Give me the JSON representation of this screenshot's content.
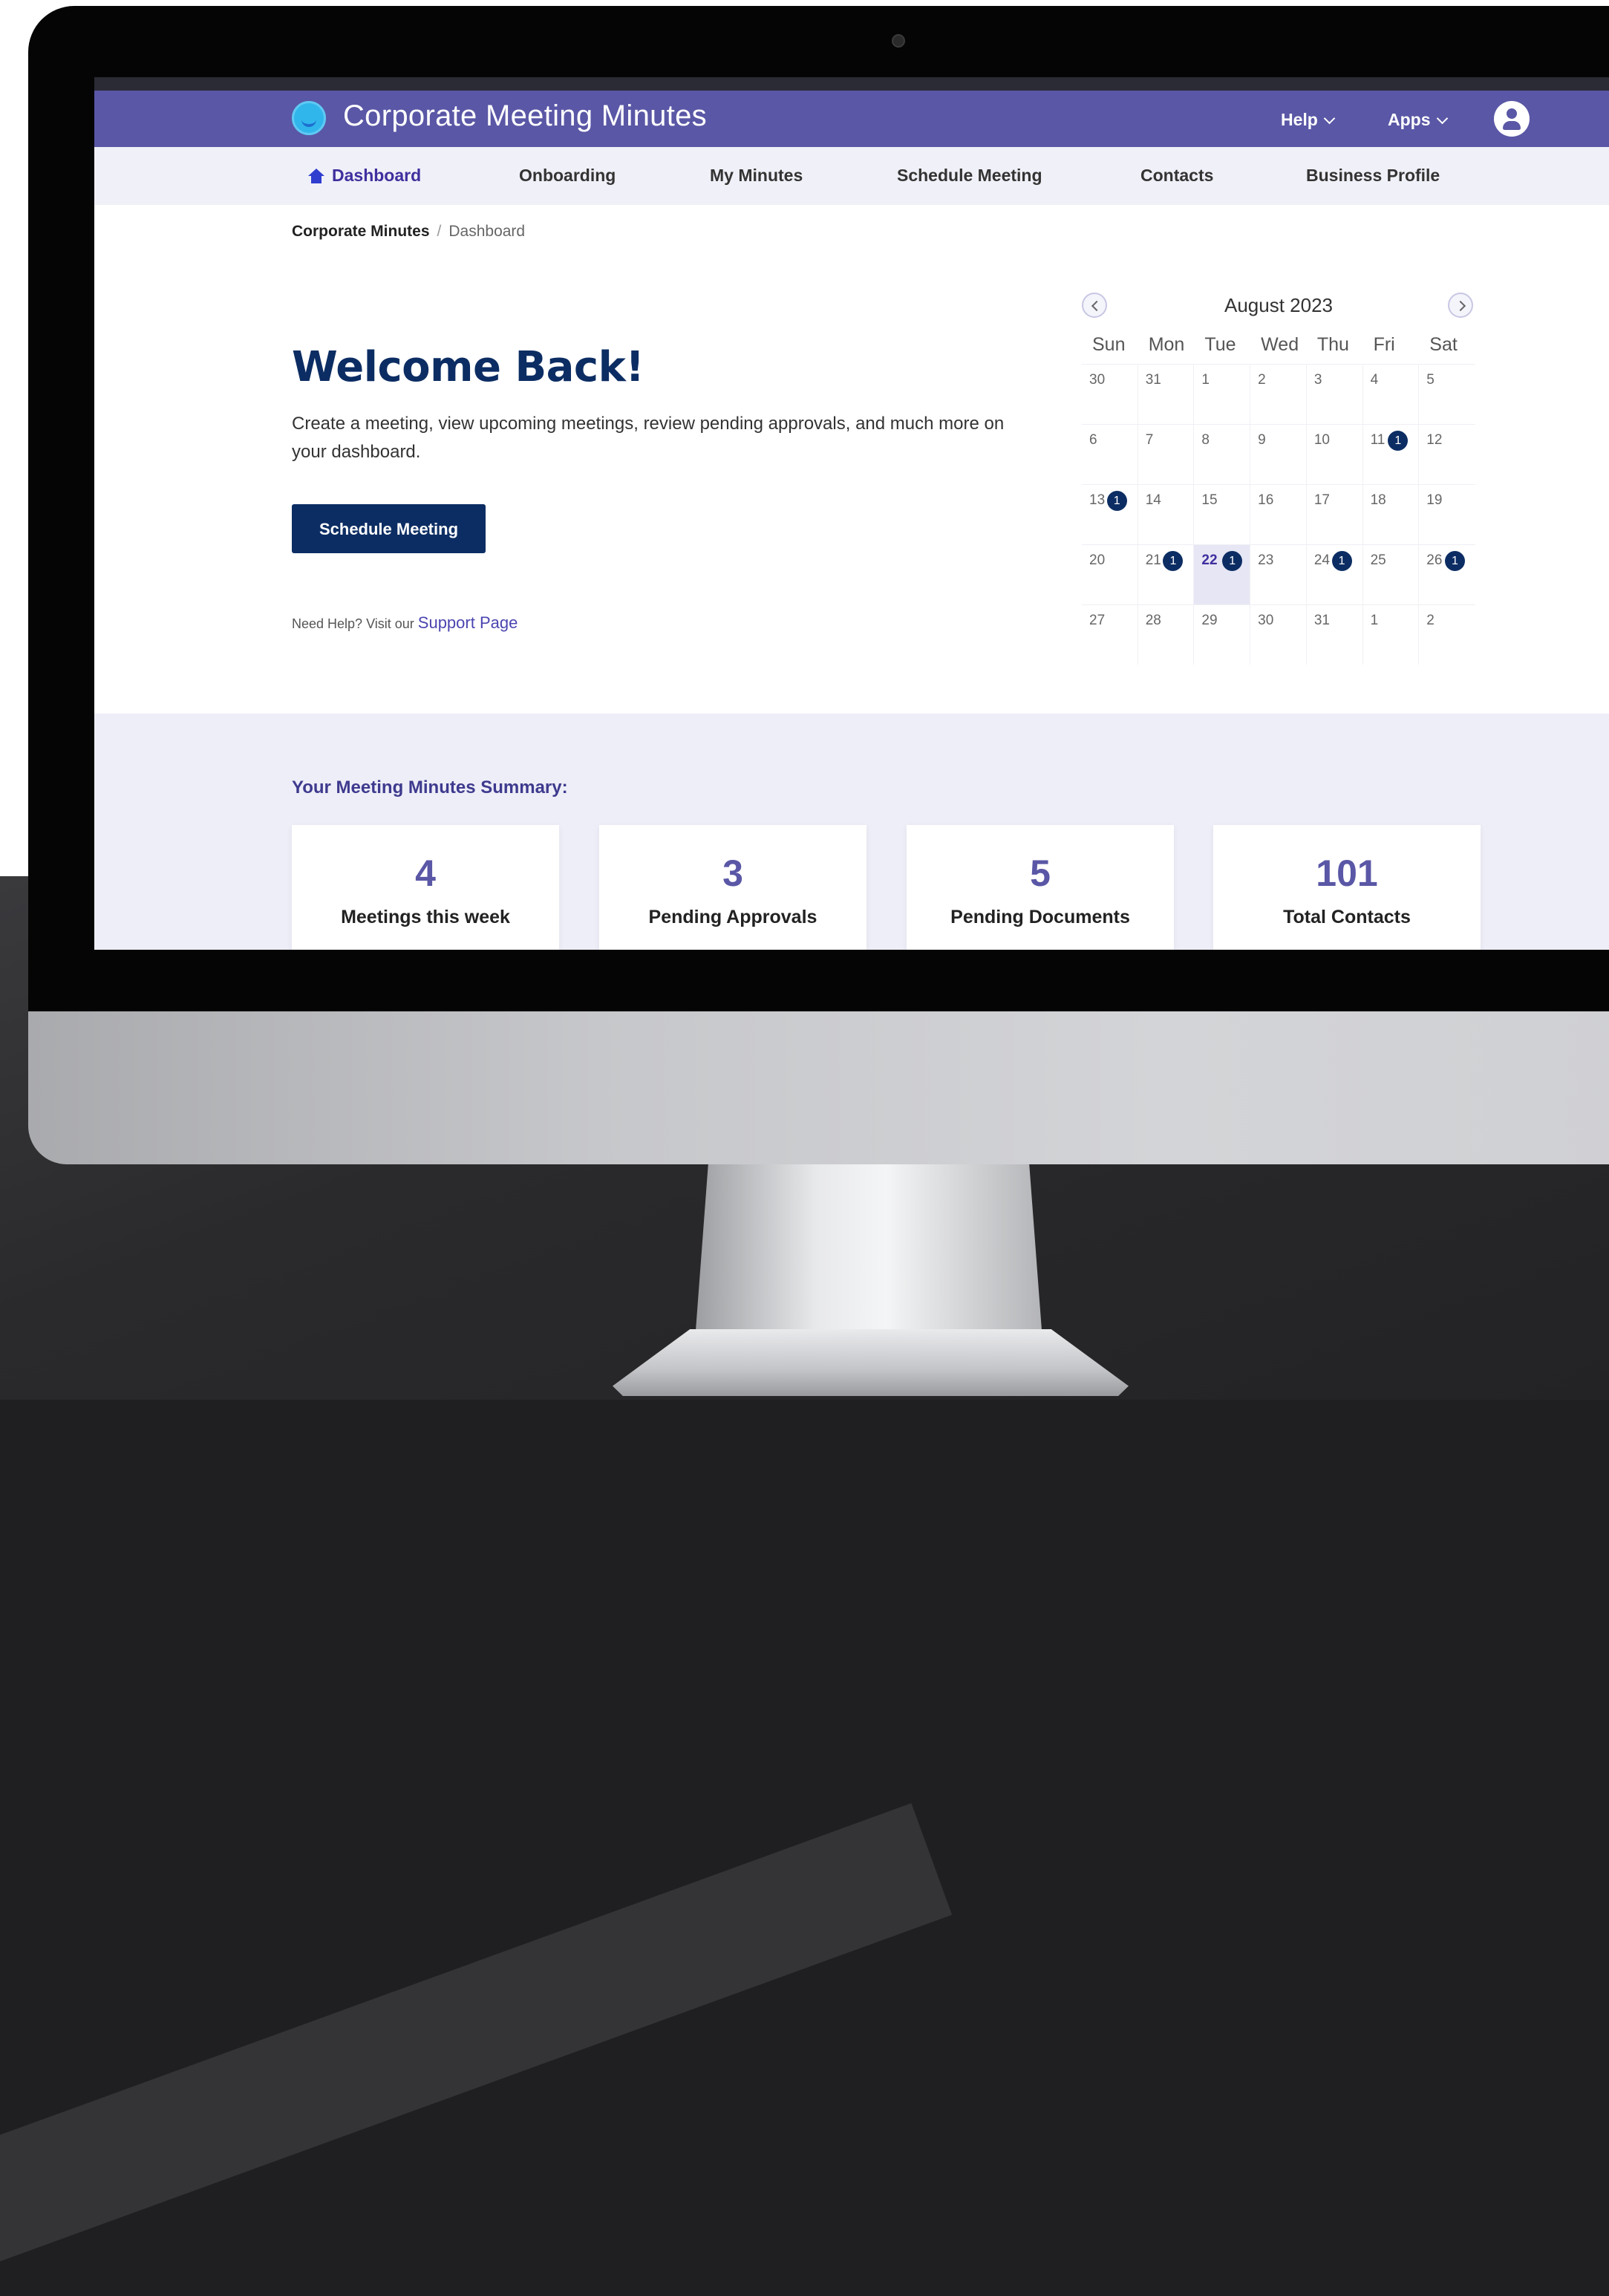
{
  "app": {
    "title": "Corporate Meeting Minutes"
  },
  "top_menu": {
    "help": "Help",
    "apps": "Apps"
  },
  "nav": {
    "items": [
      {
        "label": "Dashboard",
        "active": true
      },
      {
        "label": "Onboarding"
      },
      {
        "label": "My Minutes"
      },
      {
        "label": "Schedule Meeting"
      },
      {
        "label": "Contacts"
      },
      {
        "label": "Business Profile"
      }
    ]
  },
  "breadcrumb": {
    "root": "Corporate Minutes",
    "separator": "/",
    "current": "Dashboard"
  },
  "hero": {
    "heading": "Welcome Back!",
    "description": "Create a meeting, view upcoming meetings, review pending approvals, and much more on your dashboard.",
    "button": "Schedule Meeting",
    "help_text": "Need Help? Visit our",
    "help_link": "Support Page"
  },
  "calendar": {
    "month_label": "August 2023",
    "days_of_week": [
      "Sun",
      "Mon",
      "Tue",
      "Wed",
      "Thu",
      "Fri",
      "Sat"
    ],
    "weeks": [
      [
        {
          "d": "30"
        },
        {
          "d": "31"
        },
        {
          "d": "1"
        },
        {
          "d": "2"
        },
        {
          "d": "3"
        },
        {
          "d": "4"
        },
        {
          "d": "5"
        }
      ],
      [
        {
          "d": "6"
        },
        {
          "d": "7"
        },
        {
          "d": "8"
        },
        {
          "d": "9"
        },
        {
          "d": "10"
        },
        {
          "d": "11",
          "badge": "1"
        },
        {
          "d": "12"
        }
      ],
      [
        {
          "d": "13",
          "badge": "1"
        },
        {
          "d": "14"
        },
        {
          "d": "15"
        },
        {
          "d": "16"
        },
        {
          "d": "17"
        },
        {
          "d": "18"
        },
        {
          "d": "19"
        }
      ],
      [
        {
          "d": "20"
        },
        {
          "d": "21",
          "badge": "1"
        },
        {
          "d": "22",
          "badge": "1",
          "today": true
        },
        {
          "d": "23"
        },
        {
          "d": "24",
          "badge": "1"
        },
        {
          "d": "25"
        },
        {
          "d": "26",
          "badge": "1"
        }
      ],
      [
        {
          "d": "27"
        },
        {
          "d": "28"
        },
        {
          "d": "29"
        },
        {
          "d": "30"
        },
        {
          "d": "31"
        },
        {
          "d": "1"
        },
        {
          "d": "2"
        }
      ]
    ]
  },
  "summary": {
    "title": "Your Meeting Minutes Summary:",
    "cards": [
      {
        "value": "4",
        "label": "Meetings this week"
      },
      {
        "value": "3",
        "label": "Pending Approvals"
      },
      {
        "value": "5",
        "label": "Pending Documents"
      },
      {
        "value": "101",
        "label": "Total Contacts"
      }
    ]
  },
  "colors": {
    "brand_purple": "#5a57a6",
    "navy": "#0c2d63",
    "nav_background": "#f0f0f8"
  }
}
